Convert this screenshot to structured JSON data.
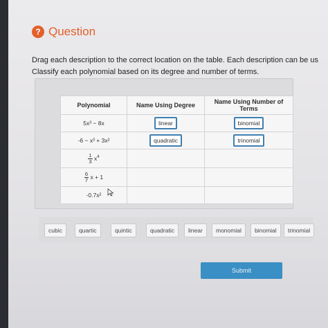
{
  "question": {
    "icon": "question-icon",
    "title": "Question",
    "accent": "#e2602b",
    "instruction_line1": "Drag each description to the correct location on the table. Each description can be us",
    "instruction_line2": "Classify each polynomial based on its degree and number of terms."
  },
  "table": {
    "headers": [
      "Polynomial",
      "Name Using Degree",
      "Name Using Number of Terms"
    ],
    "rows": [
      {
        "poly": "5x³ − 8x",
        "degree": "linear",
        "terms": "binomial"
      },
      {
        "poly": "-6 − x³ + 3x²",
        "degree": "quadratic",
        "terms": "trinomial"
      },
      {
        "poly_num": "1",
        "poly_den": "3",
        "poly_var": "x",
        "poly_exp": "4",
        "degree": "",
        "terms": ""
      },
      {
        "poly_num": "6",
        "poly_den": "7",
        "poly_tail": "x + 1",
        "degree": "",
        "terms": ""
      },
      {
        "poly": "-0.7x²",
        "degree": "",
        "terms": ""
      }
    ]
  },
  "bank": {
    "options": [
      "cubic",
      "quartic",
      "quintic",
      "quadratic",
      "linear",
      "monomial",
      "binomial",
      "trinomial"
    ]
  },
  "submit": {
    "label": "Submit",
    "color": "#3a8fc4"
  }
}
